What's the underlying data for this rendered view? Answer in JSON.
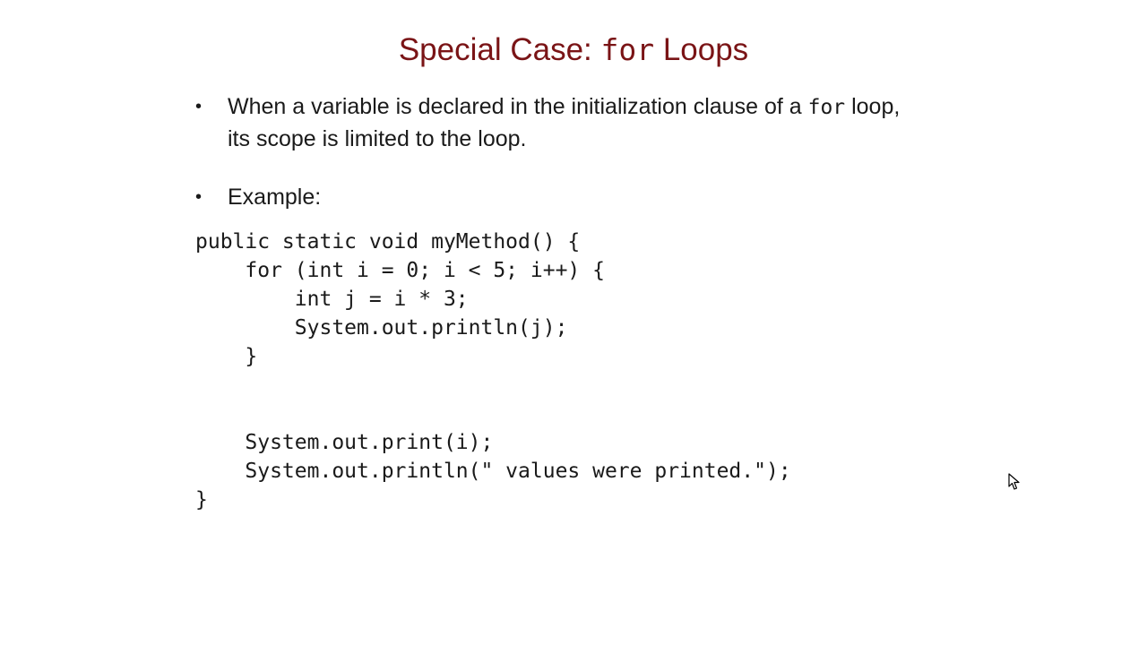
{
  "slide": {
    "title_prefix": "Special Case: ",
    "title_code": "for",
    "title_suffix": " Loops"
  },
  "bullets": [
    {
      "marker": "•",
      "part1": "When a variable is declared in the initialization clause of a ",
      "code": "for",
      "part2": " loop, its scope is limited to the loop."
    },
    {
      "marker": "•",
      "text": "Example:"
    }
  ],
  "code_lines": [
    "public static void myMethod() {",
    "    for (int i = 0; i < 5; i++) {",
    "        int j = i * 3;",
    "        System.out.println(j);",
    "    }",
    "",
    "",
    "    System.out.print(i);",
    "    System.out.println(\" values were printed.\");",
    "}"
  ],
  "icons": {
    "cursor": "mouse-pointer-icon"
  }
}
